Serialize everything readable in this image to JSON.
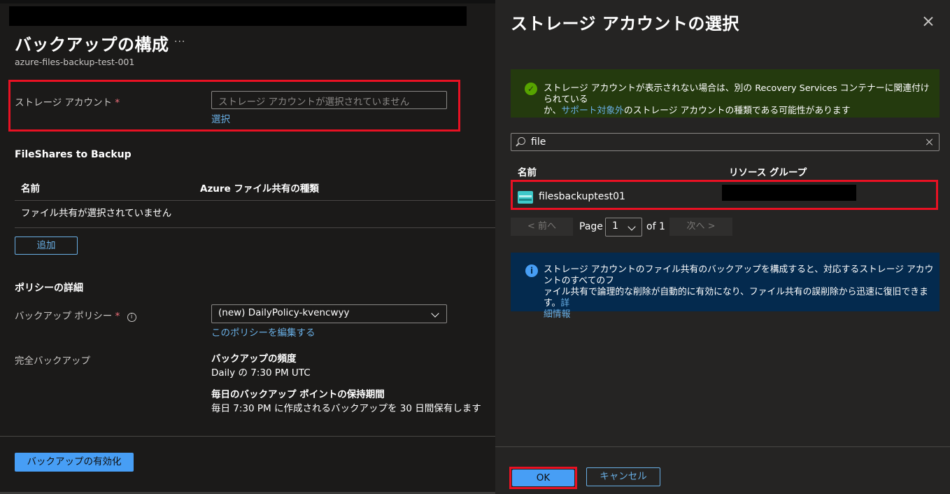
{
  "left": {
    "title": "バックアップの構成",
    "more": "···",
    "subtitle": "azure-files-backup-test-001",
    "storage": {
      "label": "ストレージ アカウント",
      "required": "*",
      "placeholder": "ストレージ アカウントが選択されていません",
      "select_link": "選択"
    },
    "fileshares": {
      "title": "FileShares to Backup",
      "columns": [
        "名前",
        "Azure ファイル共有の種類"
      ],
      "empty_text": "ファイル共有が選択されていません",
      "add_button": "追加"
    },
    "policy": {
      "title": "ポリシーの詳細",
      "label": "バックアップ ポリシー",
      "required": "*",
      "info": "i",
      "selected": "(new) DailyPolicy-kvencwyy",
      "edit_link": "このポリシーを編集する",
      "full_backup_label": "完全バックアップ",
      "frequency_title": "バックアップの頻度",
      "frequency_value": "Daily の 7:30 PM UTC",
      "retention_title": "毎日のバックアップ ポイントの保持期間",
      "retention_value": "毎日 7:30 PM に作成されるバックアップを 30 日間保有します"
    },
    "enable_button": "バックアップの有効化"
  },
  "right": {
    "title": "ストレージ アカウントの選択",
    "success_message": {
      "text_before": "ストレージ アカウントが表示されない場合は、別の Recovery Services コンテナーに関連付けられている",
      "text_prefix2": "か、",
      "link": "サポート対象外",
      "text_after": "のストレージ アカウントの種類である可能性があります"
    },
    "search": {
      "value": "file"
    },
    "table": {
      "columns": [
        "名前",
        "リソース グループ"
      ],
      "rows": [
        {
          "name": "filesbackuptest01",
          "resource_group": ""
        }
      ]
    },
    "pager": {
      "prev": "< 前へ",
      "page_label": "Page",
      "page_value": "1",
      "of_label": "of 1",
      "next": "次へ >"
    },
    "info_message": {
      "line1": "ストレージ アカウントのファイル共有のバックアップを構成すると、対応するストレージ アカウントのすべてのフ",
      "line2": "ァイル共有で論理的な削除が自動的に有効になり、ファイル共有の誤削除から迅速に復旧できます。",
      "link_part1": "詳",
      "link_part2": "細情報"
    },
    "ok_button": "OK",
    "cancel_button": "キャンセル"
  },
  "colors": {
    "highlight": "#e81123",
    "link": "#69afe5",
    "primary_button": "#479ef5",
    "success_bg": "#243a0e",
    "info_bg": "#042a4e",
    "storage_icon": "#3ec9c9"
  }
}
